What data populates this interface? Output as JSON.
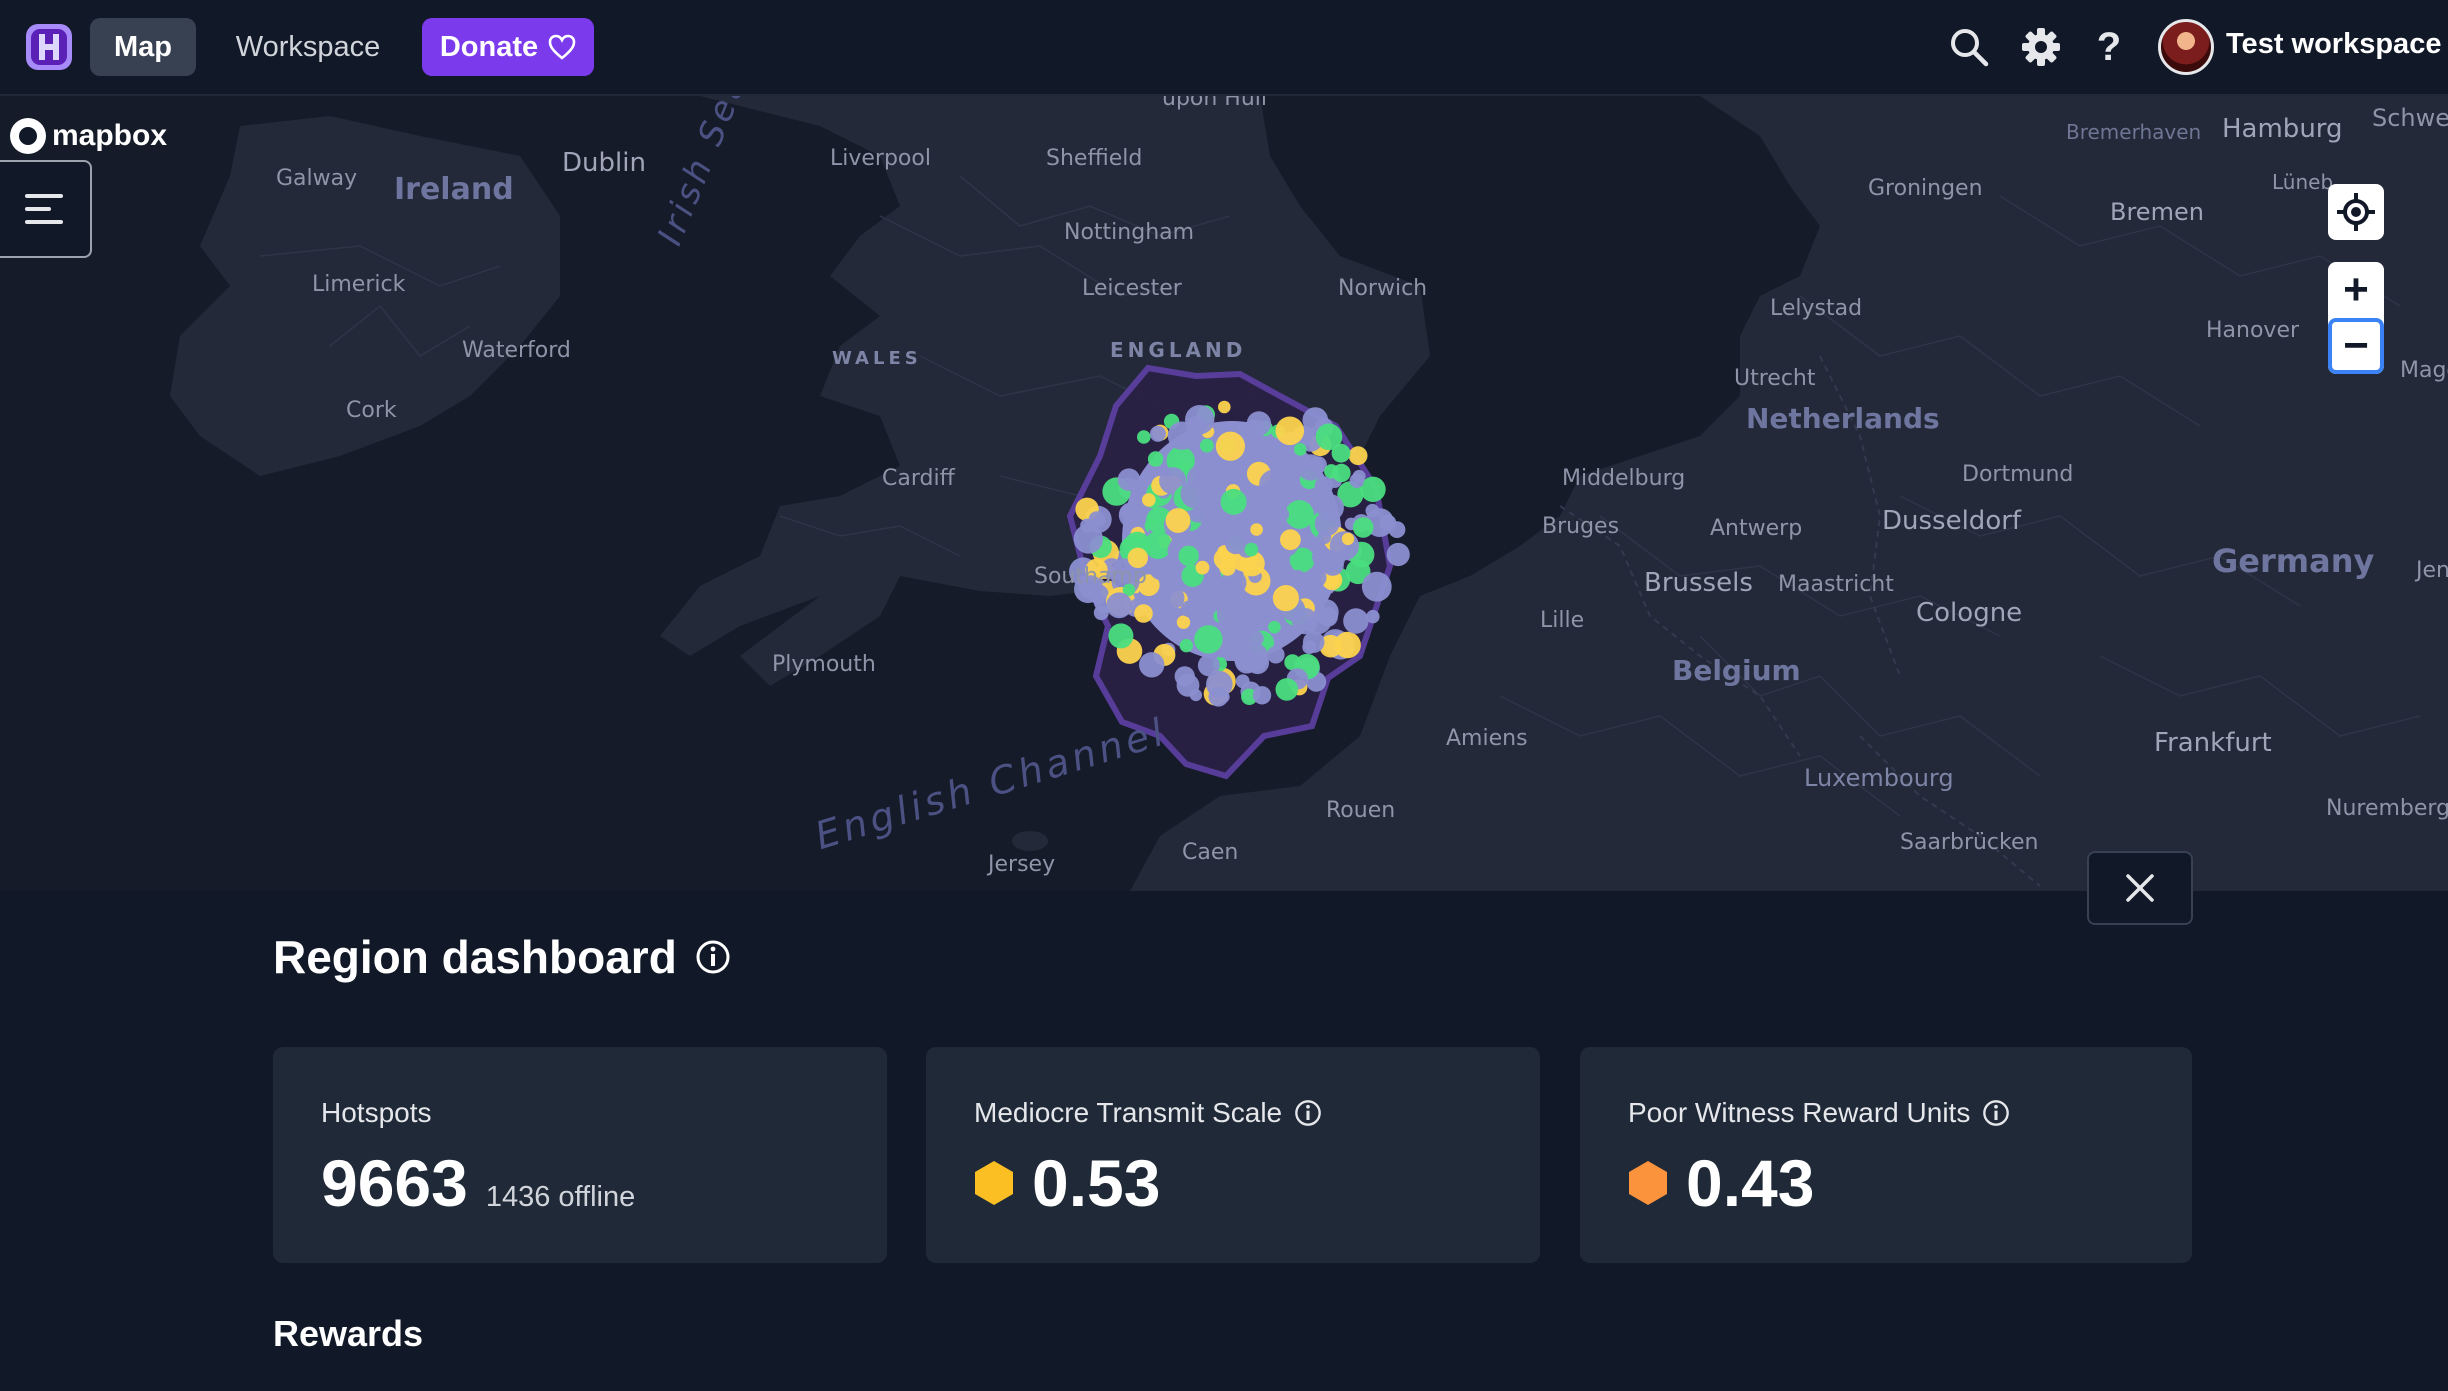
{
  "nav": {
    "map_label": "Map",
    "workspace_label": "Workspace",
    "donate_label": "Donate",
    "user_name": "Test workspace"
  },
  "map": {
    "attribution": "mapbox",
    "labels": {
      "galway": "Galway",
      "ireland": "Ireland",
      "dublin": "Dublin",
      "limerick": "Limerick",
      "waterford": "Waterford",
      "cork": "Cork",
      "irish_sea": "Irish Sea",
      "liverpool": "Liverpool",
      "sheffield": "Sheffield",
      "hull": "upon Hull",
      "nottingham": "Nottingham",
      "leicester": "Leicester",
      "norwich": "Norwich",
      "england": "ENGLAND",
      "wales": "WALES",
      "cardiff": "Cardiff",
      "southampton": "Southamp",
      "plymouth": "Plymouth",
      "english_channel": "English Channel",
      "jersey": "Jersey",
      "caen": "Caen",
      "rouen": "Rouen",
      "amiens": "Amiens",
      "lille": "Lille",
      "bruges": "Bruges",
      "middelburg": "Middelburg",
      "antwerp": "Antwerp",
      "brussels": "Brussels",
      "belgium": "Belgium",
      "maastricht": "Maastricht",
      "luxembourg": "Luxembourg",
      "saarbrucken": "Saarbrücken",
      "netherlands": "Netherlands",
      "utrecht": "Utrecht",
      "lelystad": "Lelystad",
      "groningen": "Groningen",
      "bremerhaven": "Bremerhaven",
      "hamburg": "Hamburg",
      "bremen": "Bremen",
      "hanover": "Hanover",
      "dortmund": "Dortmund",
      "dusseldorf": "Dusseldorf",
      "cologne": "Cologne",
      "germany": "Germany",
      "frankfurt": "Frankfurt",
      "nuremberg": "Nuremberg",
      "schwerin": "Schwe",
      "luneburg": "Lüneb",
      "magdeburg": "Magd",
      "jena": "Jen"
    }
  },
  "dashboard": {
    "title": "Region dashboard",
    "cards": [
      {
        "label": "Hotspots",
        "value": "9663",
        "sub": "1436 offline"
      },
      {
        "label": "Mediocre Transmit Scale",
        "value": "0.53",
        "hex_color": "#fbbf24"
      },
      {
        "label": "Poor Witness Reward Units",
        "value": "0.43",
        "hex_color": "#fb923c"
      }
    ],
    "rewards_title": "Rewards"
  },
  "colors": {
    "accent": "#7c3aed",
    "hotspot_purple": "#8b8fd0",
    "hotspot_green": "#4ade80",
    "hotspot_yellow": "#fcd34d",
    "region_border": "#5b3fa0"
  }
}
